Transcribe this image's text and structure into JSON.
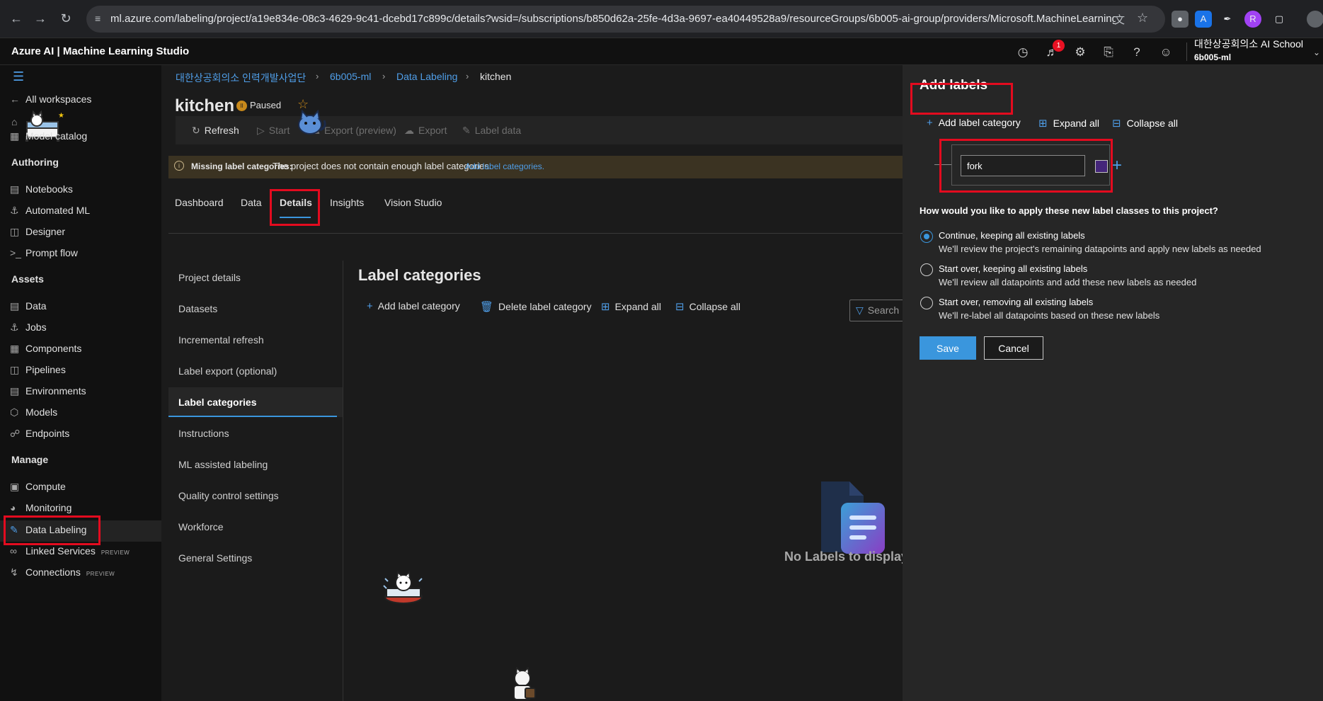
{
  "browser": {
    "url": "ml.azure.com/labeling/project/a19e834e-08c3-4629-9c41-dcebd17c899c/details?wsid=/subscriptions/b850d62a-25fe-4d3a-9697-ea40449528a9/resourceGroups/6b005-ai-group/providers/Microsoft.MachineLearningServi..."
  },
  "header": {
    "app_title": "Azure AI | Machine Learning Studio",
    "notification_count": "1",
    "org_name": "대한상공회의소 AI School",
    "workspace": "6b005-ml"
  },
  "sidebar": {
    "all_workspaces": "All workspaces",
    "model_catalog": "Model catalog",
    "authoring": "Authoring",
    "authoring_items": [
      "Notebooks",
      "Automated ML",
      "Designer",
      "Prompt flow"
    ],
    "assets": "Assets",
    "assets_items": [
      "Data",
      "Jobs",
      "Components",
      "Pipelines",
      "Environments",
      "Models",
      "Endpoints"
    ],
    "manage": "Manage",
    "manage_items": [
      "Compute",
      "Monitoring",
      "Data Labeling",
      "Linked Services",
      "Connections"
    ],
    "preview_tag": "PREVIEW"
  },
  "breadcrumb": {
    "items": [
      "대한상공회의소 인력개발사업단",
      "6b005-ml",
      "Data Labeling",
      "kitchen"
    ]
  },
  "project": {
    "title": "kitchen",
    "status": "Paused"
  },
  "toolbar": {
    "refresh": "Refresh",
    "start": "Start",
    "export_preview": "Export (preview)",
    "export": "Export",
    "label_data": "Label data"
  },
  "warning": {
    "bold": "Missing label categories:",
    "text": "The project does not contain enough label categories.",
    "link": "Add label categories."
  },
  "tabs": [
    "Dashboard",
    "Data",
    "Details",
    "Insights",
    "Vision Studio"
  ],
  "details_nav": [
    "Project details",
    "Datasets",
    "Incremental refresh",
    "Label export (optional)",
    "Label categories",
    "Instructions",
    "ML assisted labeling",
    "Quality control settings",
    "Workforce",
    "General Settings"
  ],
  "label_categories": {
    "heading": "Label categories",
    "add": "Add label category",
    "delete": "Delete label category",
    "expand": "Expand all",
    "collapse": "Collapse all",
    "search_placeholder": "Search",
    "empty_text": "No Labels to display"
  },
  "panel": {
    "title": "Add labels",
    "add_category": "Add label category",
    "expand_all": "Expand all",
    "collapse_all": "Collapse all",
    "label_value": "fork",
    "label_color": "#44257a",
    "question": "How would you like to apply these new label classes to this project?",
    "options": [
      {
        "title": "Continue, keeping all existing labels",
        "desc": "We'll review the project's remaining datapoints and apply new labels as needed"
      },
      {
        "title": "Start over, keeping all existing labels",
        "desc": "We'll review all datapoints and add these new labels as needed"
      },
      {
        "title": "Start over, removing all existing labels",
        "desc": "We'll re-label all datapoints based on these new labels"
      }
    ],
    "save": "Save",
    "cancel": "Cancel"
  },
  "colors": {
    "accent": "#3a96dd",
    "link": "#4f9ee8",
    "highlight_box": "#e30b1f",
    "warning_bg": "#3b3322"
  }
}
